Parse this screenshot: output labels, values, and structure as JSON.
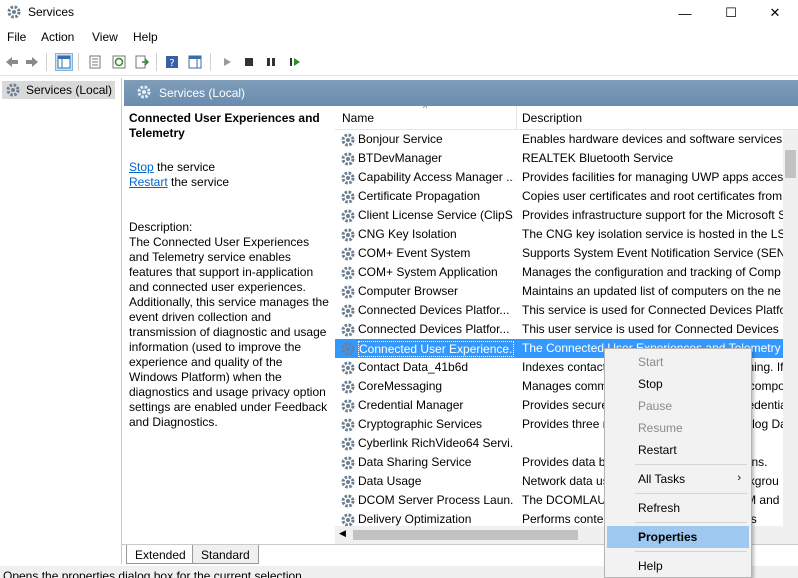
{
  "window": {
    "title": "Services",
    "minimize": "—",
    "maximize": "☐",
    "close": "✕"
  },
  "menu": [
    "File",
    "Action",
    "View",
    "Help"
  ],
  "tree": {
    "item": "Services (Local)"
  },
  "content_header": {
    "title": "Services (Local)"
  },
  "desc_pane": {
    "service_title": "Connected User Experiences and Telemetry",
    "stop_link": "Stop",
    "stop_rest": " the service",
    "restart_link": "Restart",
    "restart_rest": " the service",
    "desc_label": "Description:",
    "desc_text": "The Connected User Experiences and Telemetry service enables features that support in-application and connected user experiences. Additionally, this service manages the event driven collection and transmission of diagnostic and usage information (used to improve the experience and quality of the Windows Platform) when the diagnostics and usage privacy option settings are enabled under Feedback and Diagnostics."
  },
  "list": {
    "col_name": "Name",
    "col_desc": "Description",
    "sort_indicator": "^",
    "rows": [
      {
        "name": "Bonjour Service",
        "desc": "Enables hardware devices and software services to"
      },
      {
        "name": "BTDevManager",
        "desc": "REALTEK Bluetooth Service"
      },
      {
        "name": "Capability Access Manager ...",
        "desc": "Provides facilities for managing UWP apps access"
      },
      {
        "name": "Certificate Propagation",
        "desc": "Copies user certificates and root certificates from"
      },
      {
        "name": "Client License Service (ClipS...",
        "desc": "Provides infrastructure support for the Microsoft S"
      },
      {
        "name": "CNG Key Isolation",
        "desc": "The CNG key isolation service is hosted in the LSA"
      },
      {
        "name": "COM+ Event System",
        "desc": "Supports System Event Notification Service (SENS"
      },
      {
        "name": "COM+ System Application",
        "desc": "Manages the configuration and tracking of Comp"
      },
      {
        "name": "Computer Browser",
        "desc": "Maintains an updated list of computers on the ne"
      },
      {
        "name": "Connected Devices Platfor...",
        "desc": "This service is used for Connected Devices Platfor"
      },
      {
        "name": "Connected Devices Platfor...",
        "desc": "This user service is used for Connected Devices Pl"
      },
      {
        "name": "Connected User Experience...",
        "desc": "The Connected User Experiences and Telemetry se"
      },
      {
        "name": "Contact Data_41b6d",
        "desc": "Indexes contact data for fast contact searching. If"
      },
      {
        "name": "CoreMessaging",
        "desc": "Manages communication between system compo"
      },
      {
        "name": "Credential Manager",
        "desc": "Provides secure storage and retrieval of credential"
      },
      {
        "name": "Cryptographic Services",
        "desc": "Provides three management services: Catalog Dat"
      },
      {
        "name": "Cyberlink RichVideo64 Servi...",
        "desc": ""
      },
      {
        "name": "Data Sharing Service",
        "desc": "Provides data brokering between applications."
      },
      {
        "name": "Data Usage",
        "desc": "Network data usage, data limit, restrict backgrou"
      },
      {
        "name": "DCOM Server Process Laun...",
        "desc": "The DCOMLAUNCH service launches COM and D"
      },
      {
        "name": "Delivery Optimization",
        "desc": "Performs content delivery optimization tasks"
      }
    ]
  },
  "tabs": [
    "Extended",
    "Standard"
  ],
  "status": "Opens the properties dialog box for the current selection.",
  "context_menu": {
    "start": "Start",
    "stop": "Stop",
    "pause": "Pause",
    "resume": "Resume",
    "restart": "Restart",
    "all_tasks": "All Tasks",
    "submenu_arrow": "›",
    "refresh": "Refresh",
    "properties": "Properties",
    "help": "Help"
  },
  "colors": {
    "selection": "#3399ff",
    "header": "#7f9db9",
    "menu_highlight": "#9ec8f0"
  },
  "icons": [
    "services-app-icon",
    "back-arrow-icon",
    "forward-arrow-icon",
    "gear-icon"
  ]
}
